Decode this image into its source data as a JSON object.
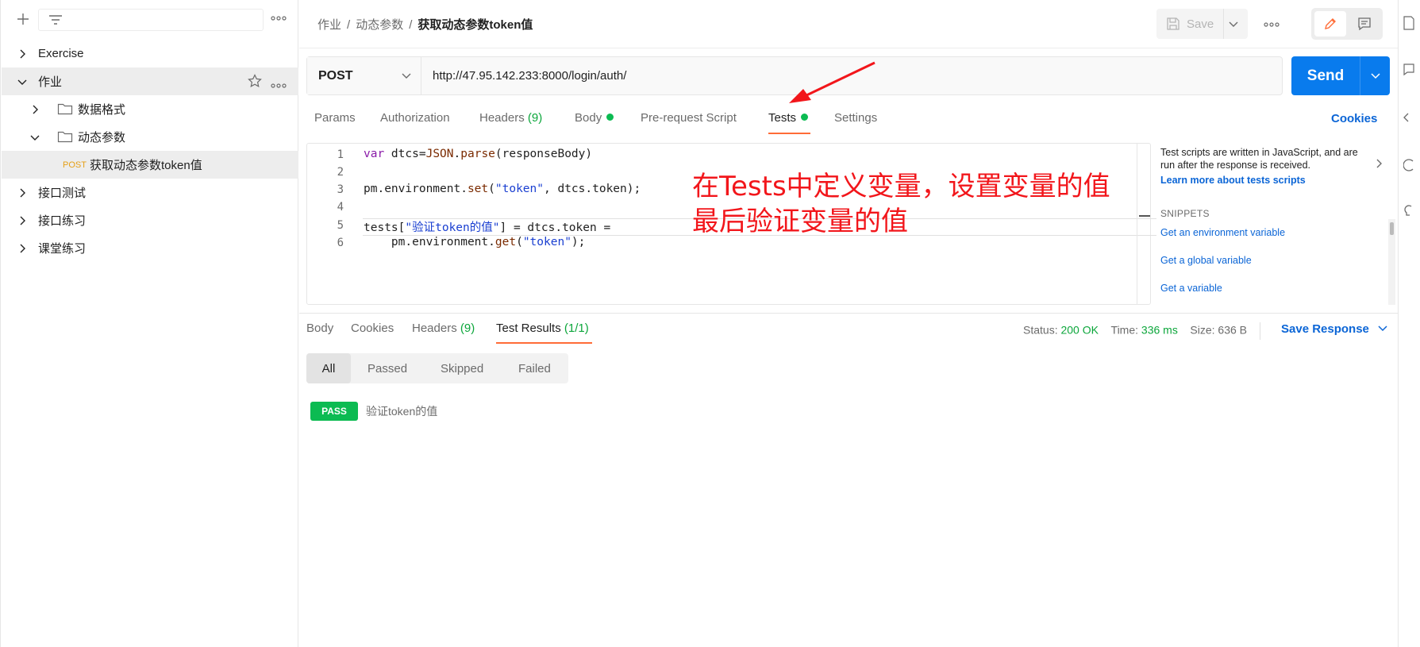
{
  "sidebar": {
    "items": [
      {
        "label": "Exercise"
      },
      {
        "label": "作业"
      },
      {
        "label": "数据格式"
      },
      {
        "label": "动态参数"
      },
      {
        "method": "POST",
        "label": "获取动态参数token值"
      },
      {
        "label": "接口测试"
      },
      {
        "label": "接口练习"
      },
      {
        "label": "课堂练习"
      }
    ]
  },
  "header": {
    "breadcrumb": [
      "作业",
      "动态参数",
      "获取动态参数token值"
    ],
    "save_label": "Save"
  },
  "request": {
    "method": "POST",
    "url": "http://47.95.142.233:8000/login/auth/",
    "send_label": "Send",
    "tabs": {
      "params": "Params",
      "authorization": "Authorization",
      "headers": "Headers",
      "headers_count": "(9)",
      "body": "Body",
      "prerequest": "Pre-request Script",
      "tests": "Tests",
      "settings": "Settings"
    },
    "cookies_label": "Cookies"
  },
  "editor": {
    "line_numbers": [
      "1",
      "2",
      "3",
      "4",
      "5",
      "6"
    ],
    "annotation_line1": "在Tests中定义变量，设置变量的值",
    "annotation_line2": "最后验证变量的值"
  },
  "snippets": {
    "description": "Test scripts are written in JavaScript, and are run after the response is received.",
    "learn_more": "Learn more about tests scripts",
    "heading": "SNIPPETS",
    "items": [
      "Get an environment variable",
      "Get a global variable",
      "Get a variable"
    ]
  },
  "response": {
    "tabs": {
      "body": "Body",
      "cookies": "Cookies",
      "headers": "Headers",
      "headers_count": "(9)",
      "test_results": "Test Results",
      "test_results_count": "(1/1)"
    },
    "status_label": "Status:",
    "status_value": "200 OK",
    "time_label": "Time:",
    "time_value": "336 ms",
    "size_label": "Size:",
    "size_value": "636 B",
    "save_response": "Save Response",
    "filters": [
      "All",
      "Passed",
      "Skipped",
      "Failed"
    ],
    "result": {
      "badge": "PASS",
      "name": "验证token的值"
    }
  },
  "colors": {
    "accent": "#ff6c37",
    "send": "#097bed",
    "pass": "#0cbb52",
    "link": "#0b65d6",
    "annotation": "#f2161b"
  }
}
